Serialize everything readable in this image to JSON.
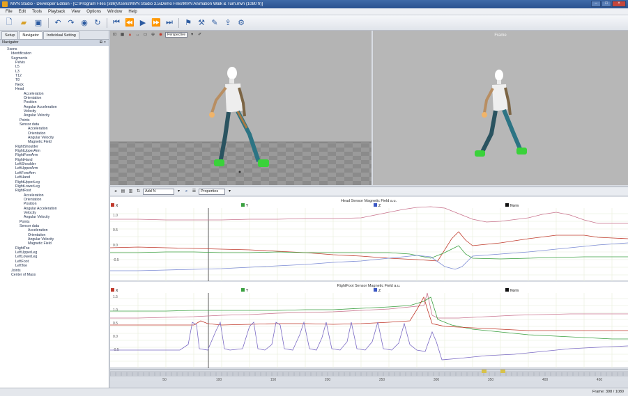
{
  "window": {
    "title": "MVN Studio - Developer Edition - [C:\\Program Files (x86)\\Xsens\\MVN Studio 3.5\\Demo Files\\MVN Animation Walk & Turn.mvn (1080 fr)]",
    "buttons": [
      "–",
      "□",
      "×"
    ]
  },
  "menu": [
    "File",
    "Edit",
    "Tools",
    "Playback",
    "View",
    "Options",
    "Window",
    "Help"
  ],
  "tree_items": [
    {
      "label": "Xsens",
      "indent": 1
    },
    {
      "label": "Identification",
      "indent": 2
    },
    {
      "label": "Segments",
      "indent": 2
    },
    {
      "label": "Pelvis",
      "indent": 3
    },
    {
      "label": "L5",
      "indent": 3
    },
    {
      "label": "L3",
      "indent": 3
    },
    {
      "label": "T12",
      "indent": 3
    },
    {
      "label": "T8",
      "indent": 3
    },
    {
      "label": "Neck",
      "indent": 3
    },
    {
      "label": "Head",
      "indent": 3
    },
    {
      "label": "Acceleration",
      "indent": 5
    },
    {
      "label": "Orientation",
      "indent": 5
    },
    {
      "label": "Position",
      "indent": 5
    },
    {
      "label": "Angular Acceleration",
      "indent": 5
    },
    {
      "label": "Velocity",
      "indent": 5
    },
    {
      "label": "Angular Velocity",
      "indent": 5
    },
    {
      "label": "Points",
      "indent": 4
    },
    {
      "label": "Sensor data",
      "indent": 4
    },
    {
      "label": "Acceleration",
      "indent": 6
    },
    {
      "label": "Orientation",
      "indent": 6
    },
    {
      "label": "Angular Velocity",
      "indent": 6
    },
    {
      "label": "Magnetic Field",
      "indent": 6
    },
    {
      "label": "RightShoulder",
      "indent": 3
    },
    {
      "label": "RightUpperArm",
      "indent": 3
    },
    {
      "label": "RightForeArm",
      "indent": 3
    },
    {
      "label": "RightHand",
      "indent": 3
    },
    {
      "label": "LeftShoulder",
      "indent": 3
    },
    {
      "label": "LeftUpperArm",
      "indent": 3
    },
    {
      "label": "LeftForeArm",
      "indent": 3
    },
    {
      "label": "LeftHand",
      "indent": 3
    },
    {
      "label": "RightUpperLeg",
      "indent": 3
    },
    {
      "label": "RightLowerLeg",
      "indent": 3
    },
    {
      "label": "RightFoot",
      "indent": 3
    },
    {
      "label": "Acceleration",
      "indent": 5
    },
    {
      "label": "Orientation",
      "indent": 5
    },
    {
      "label": "Position",
      "indent": 5
    },
    {
      "label": "Angular Acceleration",
      "indent": 5
    },
    {
      "label": "Velocity",
      "indent": 5
    },
    {
      "label": "Angular Velocity",
      "indent": 5
    },
    {
      "label": "Points",
      "indent": 4
    },
    {
      "label": "Sensor data",
      "indent": 4
    },
    {
      "label": "Acceleration",
      "indent": 6
    },
    {
      "label": "Orientation",
      "indent": 6
    },
    {
      "label": "Angular Velocity",
      "indent": 6
    },
    {
      "label": "Magnetic Field",
      "indent": 6
    },
    {
      "label": "RightToe",
      "indent": 3
    },
    {
      "label": "LeftUpperLeg",
      "indent": 3
    },
    {
      "label": "LeftLowerLeg",
      "indent": 3
    },
    {
      "label": "LeftFoot",
      "indent": 3
    },
    {
      "label": "LeftToe",
      "indent": 3
    },
    {
      "label": "Joints",
      "indent": 2
    },
    {
      "label": "Center of Mass",
      "indent": 2
    }
  ],
  "tabs": [
    "Setup",
    "Navigator",
    "Individual Setting"
  ],
  "active_tab": "Navigator",
  "panel_title": "Navigator",
  "viewport": {
    "right_title": "Frame",
    "camera_label": "Perspective"
  },
  "graph_toolbar": {
    "dropdown_value": "Add N",
    "dropdown2": "Properties"
  },
  "graphs": [
    {
      "title": "Head Sensor Magnetic Field a.u.",
      "legend": [
        "X",
        "Y",
        "Z",
        "Norm"
      ],
      "yticks": [
        "1.0",
        "0.5",
        "0.0",
        "-0.5"
      ]
    },
    {
      "title": "RightFoot Sensor Magnetic Field a.u.",
      "legend": [
        "X",
        "Y",
        "Z",
        "Norm"
      ],
      "yticks": [
        "1.5",
        "1.0",
        "0.5",
        "0.0",
        "-0.5"
      ]
    }
  ],
  "colors": {
    "x": "#c0392b",
    "y": "#3aa040",
    "z": "#3b57c4",
    "norm": "#9b4aa0",
    "accent": "#2a5290"
  },
  "timeline_labels": [
    "50",
    "100",
    "150",
    "200",
    "250",
    "300",
    "350",
    "400",
    "450"
  ],
  "status": "Frame: 398 / 1080"
}
